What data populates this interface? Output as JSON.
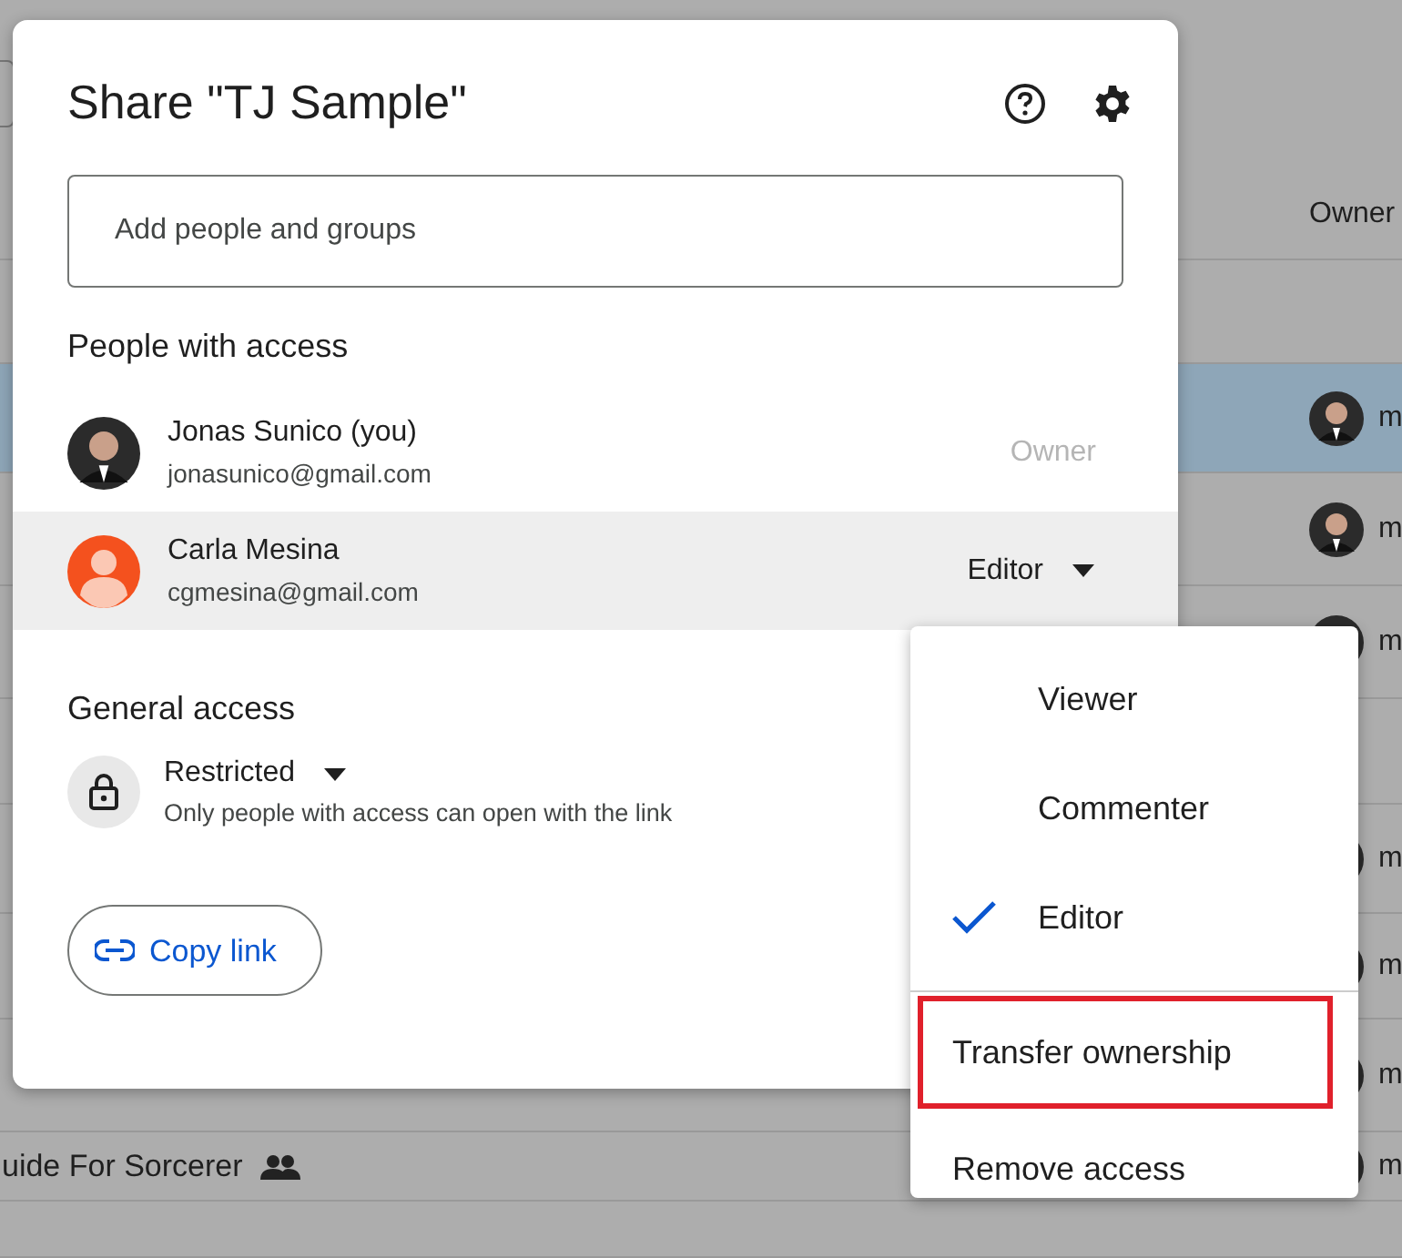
{
  "background": {
    "column_header": "Owner",
    "rows": [
      {
        "selected": false
      },
      {
        "selected": true,
        "owner": "m"
      },
      {
        "selected": false,
        "owner": "m"
      },
      {
        "selected": false,
        "owner": "m"
      },
      {
        "selected": false
      },
      {
        "selected": false,
        "owner": "m"
      },
      {
        "selected": false,
        "owner": "m"
      },
      {
        "selected": false,
        "owner": "m"
      },
      {
        "selected": false,
        "name": "uide For Sorcerer",
        "shared": true,
        "owner": "m"
      },
      {
        "selected": false
      }
    ]
  },
  "dialog": {
    "title": "Share \"TJ Sample\"",
    "search": {
      "placeholder": "Add people and groups"
    },
    "people_heading": "People with access",
    "people": [
      {
        "name": "Jonas Sunico (you)",
        "email": "jonasunico@gmail.com",
        "role": "Owner",
        "kind": "photo",
        "role_editable": false,
        "selected": false
      },
      {
        "name": "Carla Mesina",
        "email": "cgmesina@gmail.com",
        "role": "Editor",
        "kind": "placeholder",
        "role_editable": true,
        "selected": true
      }
    ],
    "general_heading": "General access",
    "access": {
      "label": "Restricted",
      "description": "Only people with access can open with the link"
    },
    "copy_link": "Copy link"
  },
  "menu": {
    "roles": [
      {
        "label": "Viewer",
        "checked": false
      },
      {
        "label": "Commenter",
        "checked": false
      },
      {
        "label": "Editor",
        "checked": true
      }
    ],
    "actions": [
      {
        "label": "Transfer ownership",
        "highlighted": true
      },
      {
        "label": "Remove access",
        "highlighted": false
      }
    ]
  }
}
